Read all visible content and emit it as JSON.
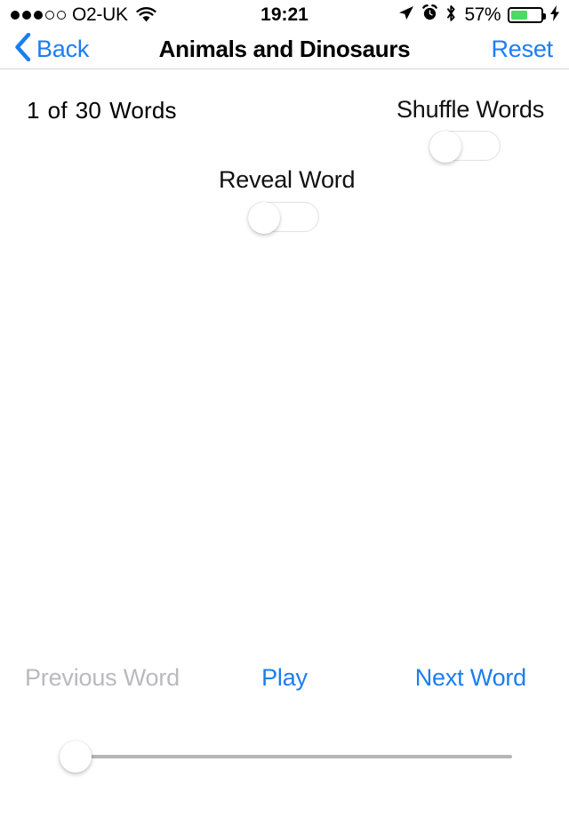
{
  "status_bar": {
    "signal_dots_filled": 3,
    "signal_dots_total": 5,
    "carrier": "O2-UK",
    "wifi_icon": "wifi-icon",
    "time": "19:21",
    "location_icon": "location-arrow-icon",
    "alarm_icon": "alarm-clock-icon",
    "bluetooth_icon": "bluetooth-icon",
    "battery_percent": "57%",
    "battery_level": 57,
    "battery_color": "#4CD964",
    "charging_icon": "lightning-bolt-icon"
  },
  "nav_bar": {
    "back_icon": "chevron-left-icon",
    "back_label": "Back",
    "title": "Animals and Dinosaurs",
    "reset_label": "Reset",
    "tint_color": "#1a7ef0"
  },
  "main": {
    "counter": {
      "current": "1",
      "of_label": "of",
      "total": "30",
      "unit_label": "Words"
    },
    "shuffle": {
      "label": "Shuffle Words",
      "value": "off"
    },
    "reveal": {
      "label": "Reveal Word",
      "value": "off"
    }
  },
  "controls": {
    "previous_label": "Previous Word",
    "previous_state": "disabled",
    "play_label": "Play",
    "next_label": "Next Word",
    "disabled_color": "#b9b9be"
  },
  "slider": {
    "name": "speed-slider",
    "value": 0,
    "min": 0,
    "max": 100
  }
}
